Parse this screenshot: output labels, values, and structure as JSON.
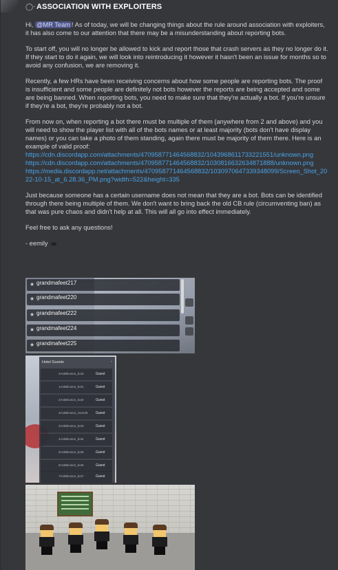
{
  "channel": {
    "title": "ASSOCIATION WITH EXPLOITERS",
    "icon": "announcement-icon"
  },
  "message": {
    "greeting_prefix": "Hi, ",
    "mention": "@MR Team",
    "p1_rest": "! As of today, we will be changing things about the rule around association with exploiters, it has also come to our attention that there may be a misunderstanding about reporting bots.",
    "p2": "To start off, you will no longer be allowed to kick and report those that crash servers as they no longer do it. If they start to do it again, we will look into reintroducing it however it hasn't been an issue for months so to avoid any confusion, we are removing it.",
    "p3": "Recently, a few HRs have been receiving concerns about how some people are reporting bots. The proof is insufficient and some people are definitely not bots however the reports are being accepted and some are being banned. When reporting bots, you need to make sure that they're actually a bot. If you're unsure if they're a bot, they're probably not a bot.",
    "p4": "From now on, when reporting a bot there must be multiple of them (anywhere from 2 and above) and you will need to show the player list with all of the bots names or at least majority (bots don't have display names) or you can take a photo of them standing, again there must be majority of them there. Here is an example of valid proof:",
    "links": [
      "https://cdn.discordapp.com/attachments/470958771464568832/1043968611733221551/unknown.png",
      "https://cdn.discordapp.com/attachments/470958771464568832/1030816632634871888/unknown.png",
      "https://media.discordapp.net/attachments/470958771464568832/1030970647339348099/Screen_Shot_2022-10-15_at_6.28.36_PM.png?width=522&height=335"
    ],
    "p5": "Just because someone has a certain username does not mean that they are a bot. Bots can be identified through there being multiple of them. We don't want to bring back the old CB rule (circumventing ban) as that was pure chaos and didn't help at all. This will all go into effect immediately.",
    "p6": "Feel free to ask any questions!",
    "signature": "- eemily"
  },
  "player_list": [
    "grandmafeet217",
    "grandmafeet220",
    "grandmafeet222",
    "grandmafeet224",
    "grandmafeet225"
  ],
  "hotel_guests": {
    "title": "Hotel Guests",
    "close": "-",
    "rows": [
      {
        "name": "2AntiBloxton_bot3",
        "status": "Guest"
      },
      {
        "name": "1AntiBloxton_bot1",
        "status": "Guest"
      },
      {
        "name": "2AntiBloxton_bot2",
        "status": "Guest"
      },
      {
        "name": "3AntiBloxton_Hom39",
        "status": "Guest"
      },
      {
        "name": "3AntiBloxton_bot3",
        "status": "Guest"
      },
      {
        "name": "4AntiBloxton_bot4",
        "status": "Guest"
      },
      {
        "name": "5AntiBloxton_bot5",
        "status": "Guest"
      },
      {
        "name": "6AntiBloxton_bot6",
        "status": "Guest"
      },
      {
        "name": "7AntiBloxton_bot7",
        "status": "Guest"
      }
    ]
  },
  "colors": {
    "background": "#36373b",
    "mention_bg": "#4e5589",
    "link": "#4aa3e6"
  }
}
